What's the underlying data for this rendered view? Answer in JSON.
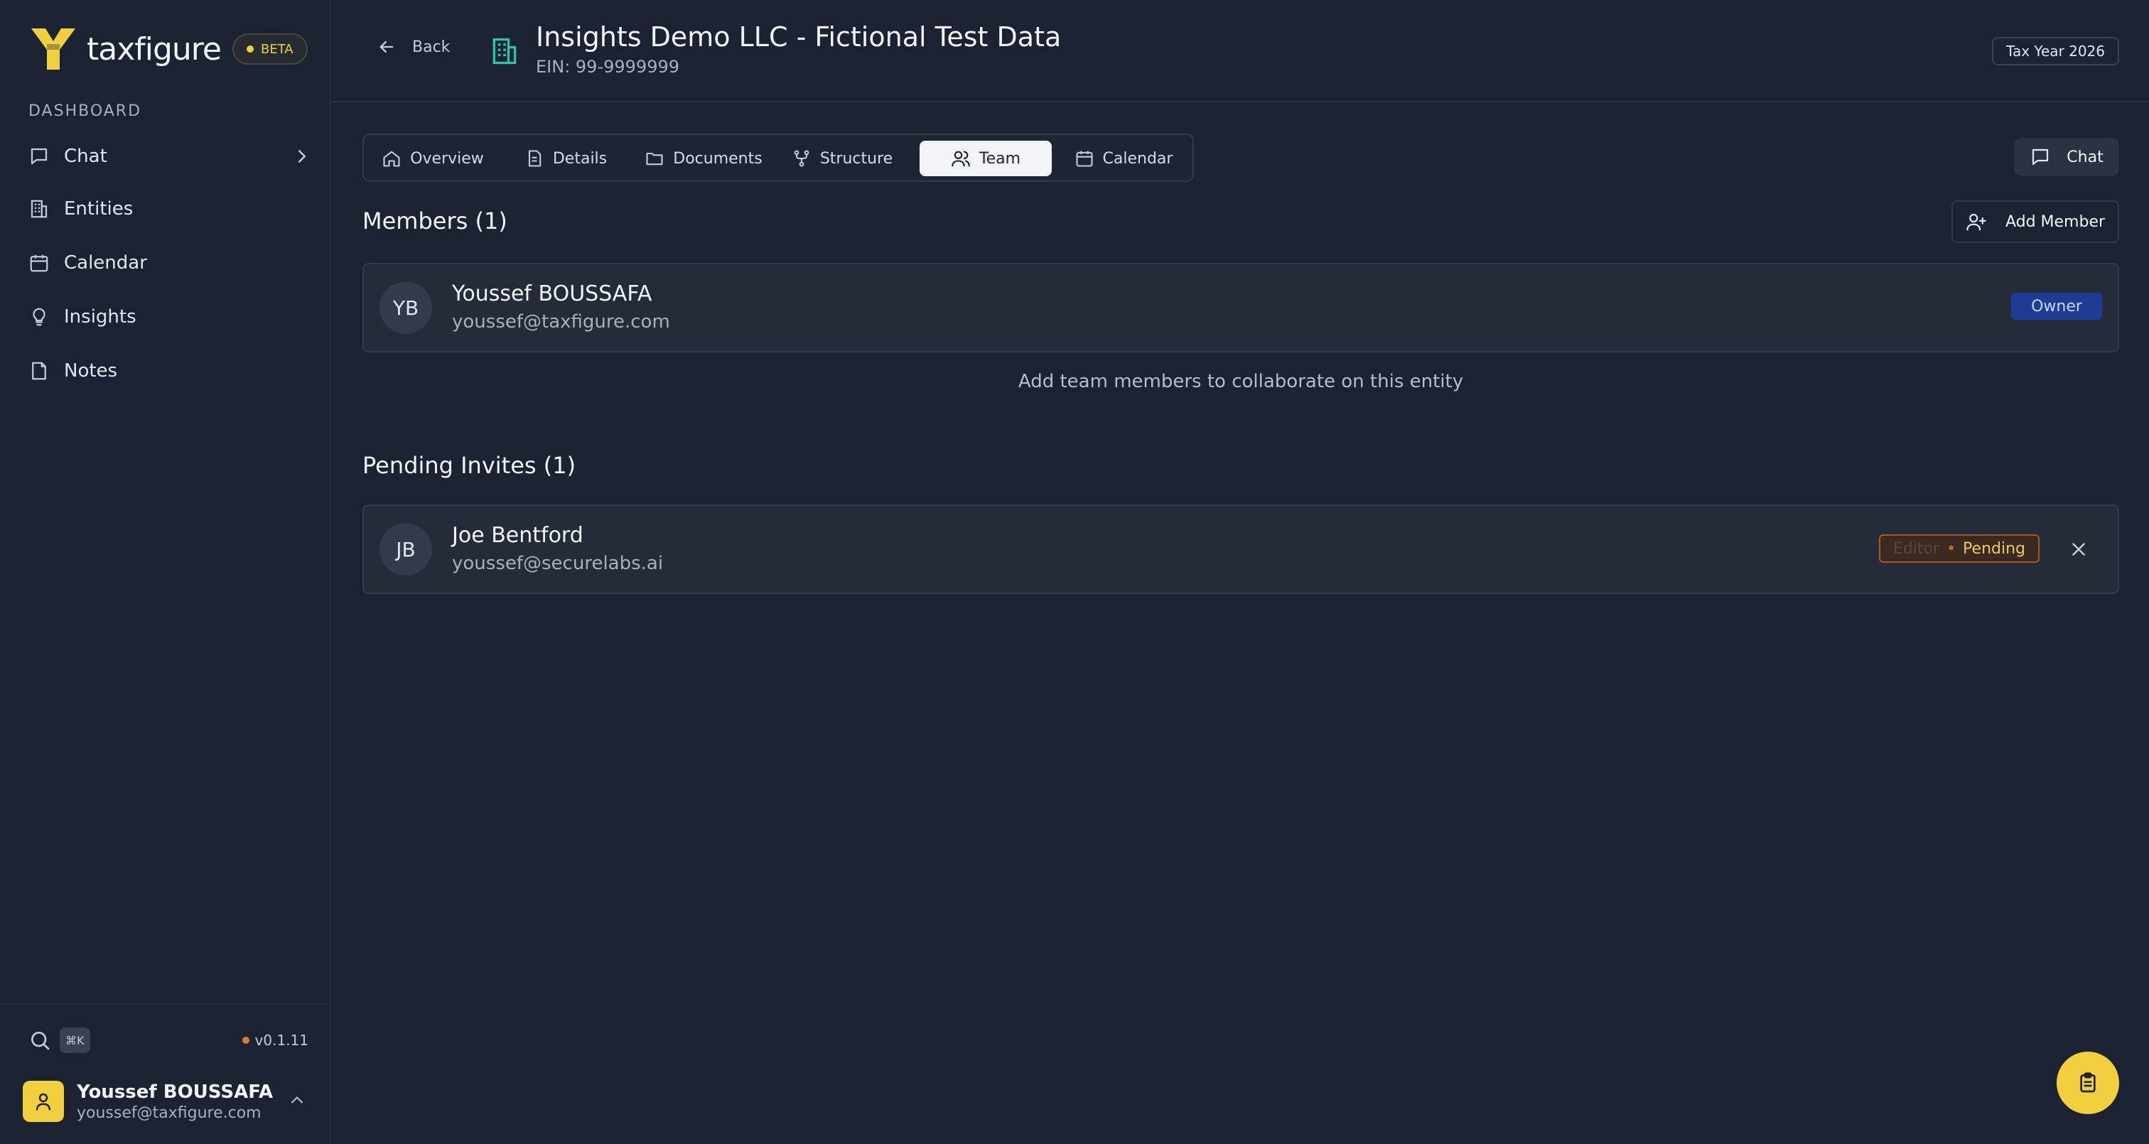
{
  "app": {
    "name": "taxfigure",
    "badge": "BETA",
    "brand_color": "#f2cf3e",
    "version": "v0.1.11",
    "search_shortcut": "⌘K"
  },
  "sidebar": {
    "section_label": "DASHBOARD",
    "items": [
      {
        "label": "Chat",
        "icon": "message-square-icon",
        "has_chevron": true
      },
      {
        "label": "Entities",
        "icon": "building-icon"
      },
      {
        "label": "Calendar",
        "icon": "calendar-icon"
      },
      {
        "label": "Insights",
        "icon": "lightbulb-icon"
      },
      {
        "label": "Notes",
        "icon": "sticky-note-icon"
      }
    ]
  },
  "user": {
    "name": "Youssef BOUSSAFA",
    "email": "youssef@taxfigure.com"
  },
  "header": {
    "back_label": "Back",
    "title": "Insights Demo LLC - Fictional Test Data",
    "ein": "EIN: 99-9999999",
    "tax_year": "Tax Year 2026"
  },
  "tabs": [
    {
      "label": "Overview",
      "icon": "home-icon",
      "active": false
    },
    {
      "label": "Details",
      "icon": "file-text-icon",
      "active": false
    },
    {
      "label": "Documents",
      "icon": "folder-icon",
      "active": false
    },
    {
      "label": "Structure",
      "icon": "git-fork-icon",
      "active": false
    },
    {
      "label": "Team",
      "icon": "users-icon",
      "active": true
    },
    {
      "label": "Calendar",
      "icon": "calendar-icon",
      "active": false
    }
  ],
  "chat_button": {
    "label": "Chat"
  },
  "members": {
    "title": "Members (1)",
    "add_label": "Add Member",
    "list": [
      {
        "initials": "YB",
        "name": "Youssef BOUSSAFA",
        "email": "youssef@taxfigure.com",
        "role": "Owner"
      }
    ],
    "empty_hint": "Add team members to collaborate on this entity"
  },
  "invites": {
    "title": "Pending Invites (1)",
    "list": [
      {
        "initials": "JB",
        "name": "Joe Bentford",
        "email": "youssef@securelabs.ai",
        "role": "Editor",
        "separator": "•",
        "status": "Pending"
      }
    ]
  }
}
